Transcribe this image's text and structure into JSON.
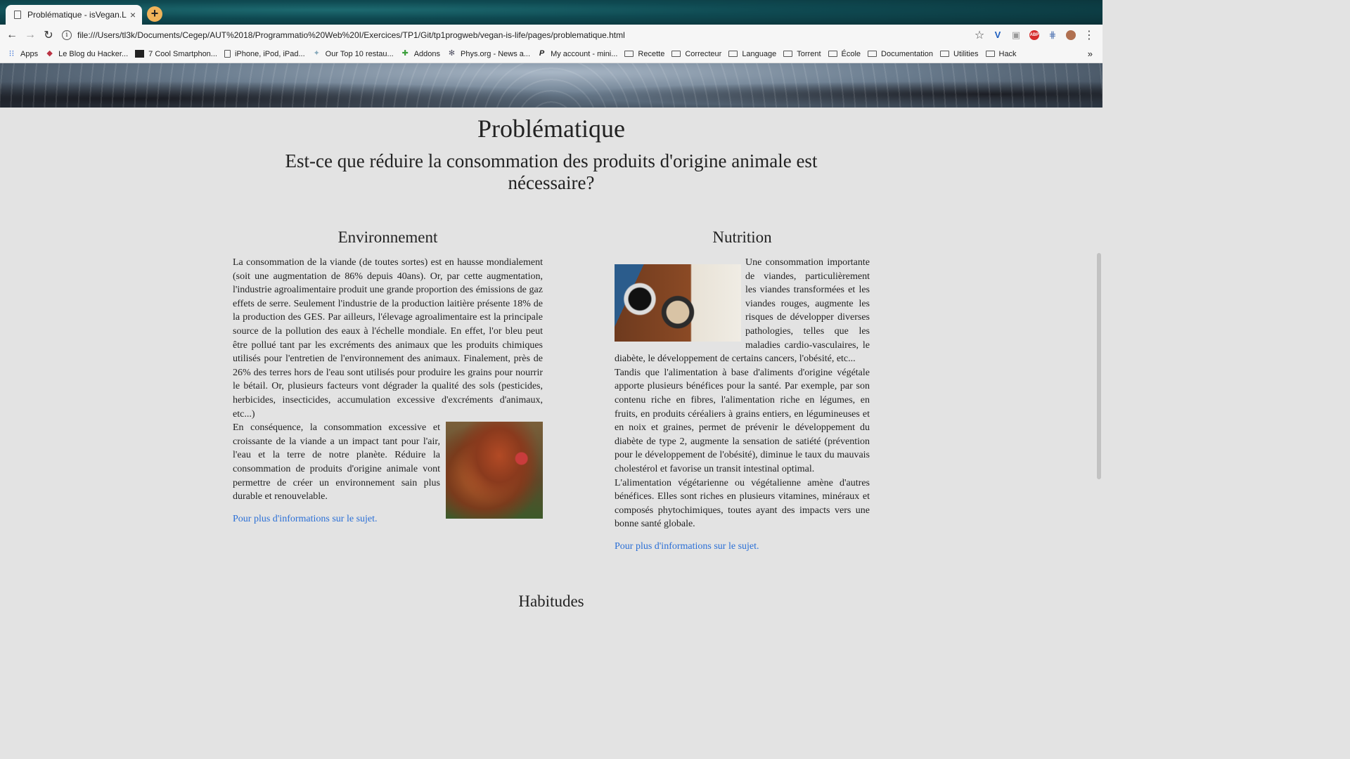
{
  "browser": {
    "tab_title": "Problématique - isVegan.Life",
    "tab_close": "×",
    "new_tab": "+",
    "url": "file:///Users/tl3k/Documents/Cegep/AUT%2018/Programmatio%20Web%20I/Exercices/TP1/Git/tp1progweb/vegan-is-life/pages/problematique.html",
    "bookmarks": [
      {
        "label": "Apps",
        "icon": "apps-grid-icon"
      },
      {
        "label": "Le Blog du Hacker...",
        "icon": "hacker-blog-icon"
      },
      {
        "label": "7 Cool Smartphon...",
        "icon": "dark-site-icon"
      },
      {
        "label": "iPhone, iPod, iPad...",
        "icon": "page-icon"
      },
      {
        "label": "Our Top 10 restau...",
        "icon": "star-site-icon"
      },
      {
        "label": "Addons",
        "icon": "puzzle-icon"
      },
      {
        "label": "Phys.org - News a...",
        "icon": "physorg-icon"
      },
      {
        "label": "My account - mini...",
        "icon": "paypal-icon"
      },
      {
        "label": "Recette",
        "icon": "folder-icon"
      },
      {
        "label": "Correcteur",
        "icon": "folder-icon"
      },
      {
        "label": "Language",
        "icon": "folder-icon"
      },
      {
        "label": "Torrent",
        "icon": "folder-icon"
      },
      {
        "label": "École",
        "icon": "folder-icon"
      },
      {
        "label": "Documentation",
        "icon": "folder-icon"
      },
      {
        "label": "Utilities",
        "icon": "folder-icon"
      },
      {
        "label": "Hack",
        "icon": "folder-icon"
      }
    ],
    "more_bookmarks": "»"
  },
  "page": {
    "title": "Problématique",
    "question": "Est-ce que réduire la consommation des produits d'origine animale est nécessaire?",
    "environment": {
      "heading": "Environnement",
      "p1": "La consommation de la viande (de toutes sortes) est en hausse mondialement (soit une augmentation de 86% depuis 40ans). Or, par cette augmentation, l'industrie agroalimentaire produit une grande proportion des émissions de gaz effets de serre. Seulement l'industrie de la production laitière présente 18% de la production des GES. Par ailleurs, l'élevage agroalimentaire est la principale source de la pollution des eaux à l'échelle mondiale. En effet, l'or bleu peut être pollué tant par les excréments des animaux que les produits chimiques utilisés pour l'entretien de l'environnement des animaux. Finalement, près de 26% des terres hors de l'eau sont utilisés pour produire les grains pour nourrir le bétail. Or, plusieurs facteurs vont dégrader la qualité des sols (pesticides, herbicides, insecticides, accumulation excessive d'excréments d'animaux, etc...)",
      "p2": "En conséquence, la consommation excessive et croissante de la viande a un impact tant pour l'air, l'eau et la terre de notre planète. Réduire la consommation de produits d'origine animale vont permettre de créer un environnement sain plus durable et renouvelable.",
      "link": "Pour plus d'informations sur le sujet."
    },
    "nutrition": {
      "heading": "Nutrition",
      "p1": "Une consommation importante de viandes, particulièrement les viandes transformées et les viandes rouges, augmente les risques de développer diverses pathologies, telles que les maladies cardio-vasculaires, le diabète, le développement de certains cancers, l'obésité, etc...",
      "p2": "Tandis que l'alimentation à base d'aliments d'origine végétale apporte plusieurs bénéfices pour la santé. Par exemple, par son contenu riche en fibres, l'alimentation riche en légumes, en fruits, en produits céréaliers à grains entiers, en légumineuses et en noix et graines, permet de prévenir le développement du diabète de type 2, augmente la sensation de satiété (prévention pour le développement de l'obésité), diminue le taux du mauvais cholestérol et favorise un transit intestinal optimal.",
      "p3": "L'alimentation végétarienne ou végétalienne amène d'autres bénéfices. Elles sont riches en plusieurs vitamines, minéraux et composés phytochimiques, toutes ayant des impacts vers une bonne santé globale.",
      "link": "Pour plus d'informations sur le sujet."
    },
    "next_heading": "Habitudes"
  }
}
